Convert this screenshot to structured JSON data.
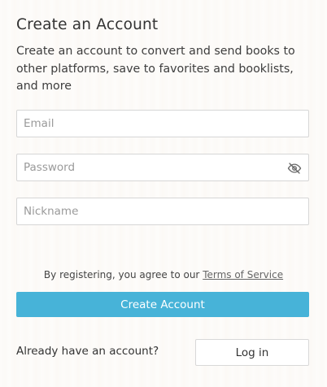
{
  "header": {
    "title": "Create an Account",
    "subtitle": "Create an account to convert and send books to other platforms, save to favorites and booklists, and more"
  },
  "form": {
    "email_placeholder": "Email",
    "password_placeholder": "Password",
    "nickname_placeholder": "Nickname",
    "password_toggle_icon": "eye-off-icon"
  },
  "terms": {
    "prefix": "By registering, you agree to our ",
    "link_label": "Terms of Service"
  },
  "actions": {
    "create_label": "Create Account",
    "already_text": "Already have an account?",
    "login_label": "Log in"
  },
  "colors": {
    "primary": "#47b3d8",
    "text": "#333333",
    "border": "#d6d6d6"
  }
}
